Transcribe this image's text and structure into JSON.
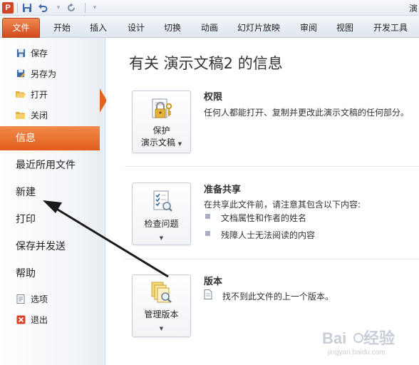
{
  "app": {
    "title_fragment": "演"
  },
  "ribbon": {
    "tabs": [
      "文件",
      "开始",
      "插入",
      "设计",
      "切换",
      "动画",
      "幻灯片放映",
      "审阅",
      "视图",
      "开发工具"
    ]
  },
  "backstage": {
    "nav_top": [
      {
        "label": "保存",
        "icon": "save-icon"
      },
      {
        "label": "另存为",
        "icon": "save-as-icon"
      },
      {
        "label": "打开",
        "icon": "open-folder-icon"
      },
      {
        "label": "关闭",
        "icon": "close-folder-icon"
      }
    ],
    "nav_main": [
      "信息",
      "最近所用文件",
      "新建",
      "打印",
      "保存并发送",
      "帮助"
    ],
    "selected": "信息",
    "nav_bottom": [
      {
        "label": "选项",
        "icon": "options-icon"
      },
      {
        "label": "退出",
        "icon": "exit-icon"
      }
    ]
  },
  "info": {
    "title": "有关 演示文稿2 的信息",
    "permissions": {
      "button_line1": "保护",
      "button_line2": "演示文稿",
      "heading": "权限",
      "description": "任何人都能打开、复制并更改此演示文稿的任何部分。"
    },
    "prepare": {
      "button_label": "检查问题",
      "heading": "准备共享",
      "description": "在共享此文件前，请注意其包含以下内容:",
      "bullets": [
        "文档属性和作者的姓名",
        "残障人士无法阅读的内容"
      ]
    },
    "versions": {
      "button_label": "管理版本",
      "heading": "版本",
      "description": "找不到此文件的上一个版本。"
    }
  },
  "colors": {
    "accent": "#e3641f",
    "file_tab": "#d24a1c"
  }
}
